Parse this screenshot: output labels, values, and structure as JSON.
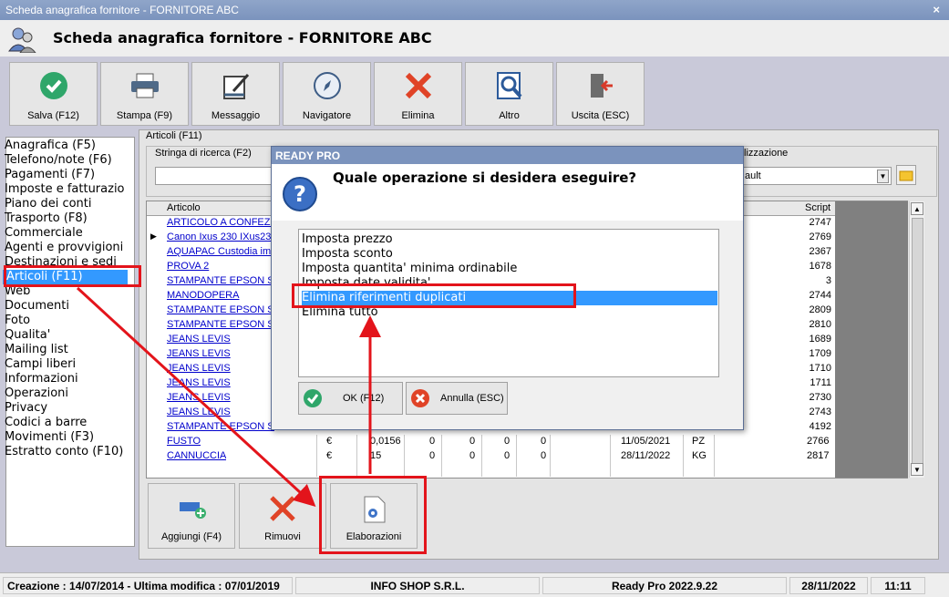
{
  "window": {
    "title": "Scheda anagrafica fornitore - FORNITORE ABC",
    "close": "×"
  },
  "header": {
    "title": "Scheda anagrafica fornitore - FORNITORE ABC"
  },
  "toolbar": {
    "buttons": [
      {
        "label": "Salva (F12)",
        "icon": "check-icon"
      },
      {
        "label": "Stampa (F9)",
        "icon": "printer-icon"
      },
      {
        "label": "Messaggio",
        "icon": "message-icon"
      },
      {
        "label": "Navigatore",
        "icon": "compass-icon"
      },
      {
        "label": "Elimina",
        "icon": "delete-x-icon"
      },
      {
        "label": "Altro",
        "icon": "search-doc-icon"
      },
      {
        "label": "Uscita (ESC)",
        "icon": "exit-icon"
      }
    ]
  },
  "sidebar": {
    "items": [
      "Anagrafica (F5)",
      "Telefono/note (F6)",
      "Pagamenti (F7)",
      "Imposte e fatturazio",
      "Piano dei conti",
      "Trasporto (F8)",
      "Commerciale",
      "Agenti e provvigioni",
      "Destinazioni e sedi",
      "Articoli (F11)",
      "Web",
      "Documenti",
      "Foto",
      "Qualita'",
      "Mailing list",
      "Campi liberi",
      "Informazioni",
      "Operazioni",
      "Privacy",
      "Codici a barre",
      "Movimenti (F3)",
      "Estratto conto (F10)"
    ],
    "selected": "Articoli (F11)"
  },
  "articles": {
    "legend": "Articoli (F11)",
    "search_legend": "Stringa di ricerca (F2)",
    "search_value": "",
    "view_label": "lizzazione",
    "view_value": "ault",
    "columns": {
      "articolo": "Articolo",
      "script": "Script"
    },
    "rows": [
      {
        "name": "ARTICOLO A CONFEZIO",
        "script": "2747"
      },
      {
        "name": "Canon Ixus 230 IXus230",
        "script": "2769"
      },
      {
        "name": "AQUAPAC Custodia imp",
        "script": "2367"
      },
      {
        "name": "PROVA 2",
        "script": "1678"
      },
      {
        "name": "STAMPANTE EPSON STY",
        "script": "3"
      },
      {
        "name": "MANODOPERA",
        "script": "2744"
      },
      {
        "name": "STAMPANTE EPSON STY",
        "script": "2809"
      },
      {
        "name": "STAMPANTE EPSON STY",
        "script": "2810"
      },
      {
        "name": "JEANS LEVIS",
        "script": "1689"
      },
      {
        "name": "JEANS LEVIS",
        "script": "1709"
      },
      {
        "name": "JEANS LEVIS",
        "script": "1710"
      },
      {
        "name": "JEANS LEVIS",
        "script": "1711"
      },
      {
        "name": "JEANS LEVIS",
        "script": "2730"
      },
      {
        "name": "JEANS LEVIS",
        "script": "2743"
      },
      {
        "name": "STAMPANTE EPSON STY",
        "script": "4192"
      }
    ],
    "bottom_rows": [
      {
        "name": "FUSTO",
        "currency": "€",
        "price": "0,0156",
        "c1": "0",
        "c2": "0",
        "c3": "0",
        "c4": "0",
        "date": "11/05/2021",
        "unit": "PZ",
        "script": "2766"
      },
      {
        "name": "CANNUCCIA",
        "currency": "€",
        "price": "15",
        "c1": "0",
        "c2": "0",
        "c3": "0",
        "c4": "0",
        "date": "28/11/2022",
        "unit": "KG",
        "script": "2817"
      }
    ],
    "row_marker": "▶"
  },
  "bottom_buttons": [
    {
      "label": "Aggiungi (F4)",
      "icon": "add-icon"
    },
    {
      "label": "Rimuovi",
      "icon": "remove-x-icon"
    },
    {
      "label": "Elaborazioni",
      "icon": "gear-doc-icon"
    }
  ],
  "dialog": {
    "title": "READY PRO",
    "question": "Quale operazione si desidera eseguire?",
    "options": [
      "Imposta prezzo",
      "Imposta sconto",
      "Imposta quantita' minima ordinabile",
      "Imposta date validita'",
      "Elimina riferimenti duplicati",
      "Elimina tutto"
    ],
    "selected_index": 4,
    "ok_label": "OK (F12)",
    "cancel_label": "Annulla (ESC)"
  },
  "statusbar": {
    "dates": "Creazione : 14/07/2014 - Ultima modifica : 07/01/2019",
    "company": "INFO SHOP S.R.L.",
    "version": "Ready Pro 2022.9.22",
    "date": "28/11/2022",
    "time": "11:11"
  },
  "colors": {
    "accent_red": "#e3141b",
    "selection": "#3399ff",
    "titlebar": "#7b93bd"
  }
}
